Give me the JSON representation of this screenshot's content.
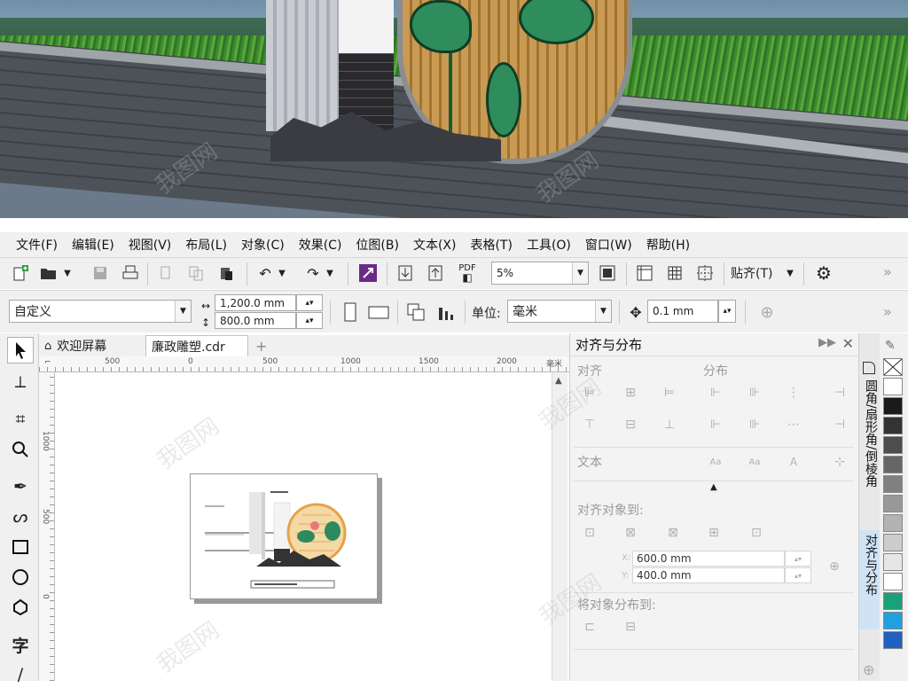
{
  "menu": [
    "文件(F)",
    "编辑(E)",
    "视图(V)",
    "布局(L)",
    "对象(C)",
    "效果(C)",
    "位图(B)",
    "文本(X)",
    "表格(T)",
    "工具(O)",
    "窗口(W)",
    "帮助(H)"
  ],
  "toolbar1": {
    "pdf_label": "PDF",
    "zoom_value": "5%",
    "snap_label": "贴齐(T)"
  },
  "toolbar2": {
    "preset_value": "自定义",
    "width_value": "1,200.0 mm",
    "height_value": "800.0 mm",
    "units_label": "单位:",
    "units_value": "毫米",
    "nudge_value": "0.1 mm"
  },
  "tabs": {
    "welcome": "欢迎屏幕",
    "document": "廉政雕塑.cdr",
    "new_tab": "+"
  },
  "ruler": {
    "h_ticks": [
      "500",
      "0",
      "500",
      "1000",
      "1500",
      "2000"
    ],
    "h_unit": "毫米",
    "v_ticks": [
      "1000",
      "500",
      "0"
    ]
  },
  "docker": {
    "title": "对齐与分布",
    "align_label": "对齐",
    "distribute_label": "分布",
    "text_label": "文本",
    "align_to_label": "对齐对象到:",
    "x_value": "600.0 mm",
    "y_value": "400.0 mm",
    "x_prefix": "X:",
    "y_prefix": "Y:",
    "distribute_to_label": "将对象分布到:"
  },
  "side_tabs": [
    "圆角/扇形角/倒棱角",
    "对齐与分布"
  ],
  "palette": [
    "#ffffff",
    "#1a1a1a",
    "#333333",
    "#4d4d4d",
    "#666666",
    "#808080",
    "#999999",
    "#b3b3b3",
    "#cccccc",
    "#e6e6e6",
    "#ffffff",
    "#1aa07a",
    "#1fa0e0",
    "#2060c0"
  ],
  "watermark_text": "我图网"
}
